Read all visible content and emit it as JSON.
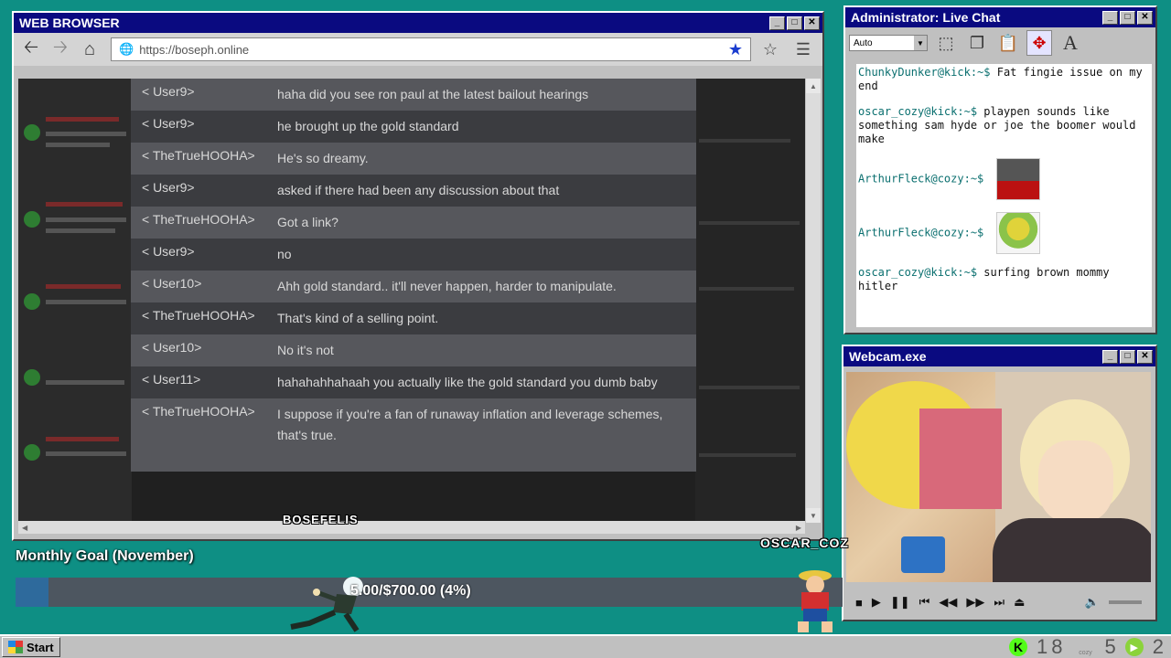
{
  "browser": {
    "title": "WEB BROWSER",
    "url": "https://boseph.online",
    "rows": [
      {
        "user": "< User9>",
        "message": "haha did you see ron paul at the latest bailout hearings"
      },
      {
        "user": "< User9>",
        "message": "he brought up the gold standard"
      },
      {
        "user": "< TheTrueHOOHA>",
        "message": "He's so dreamy."
      },
      {
        "user": "< User9>",
        "message": "asked if there had been any discussion about that"
      },
      {
        "user": "< TheTrueHOOHA>",
        "message": "Got a link?"
      },
      {
        "user": "< User9>",
        "message": "no"
      },
      {
        "user": "< User10>",
        "message": "Ahh gold standard.. it'll never happen, harder to manipulate."
      },
      {
        "user": "< TheTrueHOOHA>",
        "message": "That's kind of a selling point."
      },
      {
        "user": "< User10>",
        "message": "No it's not"
      },
      {
        "user": "< User11>",
        "message": "hahahahhahaah you actually like the gold standard you dumb baby"
      },
      {
        "user": "< TheTrueHOOHA>",
        "message": "I suppose if you're a fan of runaway inflation and leverage schemes, that's true."
      }
    ],
    "overlay_name": "BOSEFELIS"
  },
  "livechat": {
    "title": "Administrator: Live Chat",
    "select_value": "Auto",
    "messages": [
      {
        "user": "ChunkyDunker@kick:~$",
        "text": "Fat fingie issue on my end"
      },
      {
        "user": "oscar_cozy@kick:~$",
        "text": "playpen sounds like something sam hyde or joe the boomer would make"
      },
      {
        "user": "ArthurFleck@cozy:~$",
        "text": ""
      },
      {
        "user": "ArthurFleck@cozy:~$",
        "text": ""
      },
      {
        "user": "oscar_cozy@kick:~$",
        "text": "surfing brown mommy hitler"
      }
    ]
  },
  "webcam": {
    "title": "Webcam.exe"
  },
  "goal": {
    "title": "Monthly Goal (November)",
    "text": "5.00/$700.00 (4%)",
    "progress": 0.04
  },
  "overlay_name2": "OSCAR_COZ",
  "taskbar": {
    "start": "Start",
    "tray_numbers": [
      "18",
      "5",
      "2"
    ]
  },
  "colors": {
    "desktop": "#0e8f84",
    "titlebar": "#0a0a80",
    "chat_user": "#0a6f6f"
  }
}
